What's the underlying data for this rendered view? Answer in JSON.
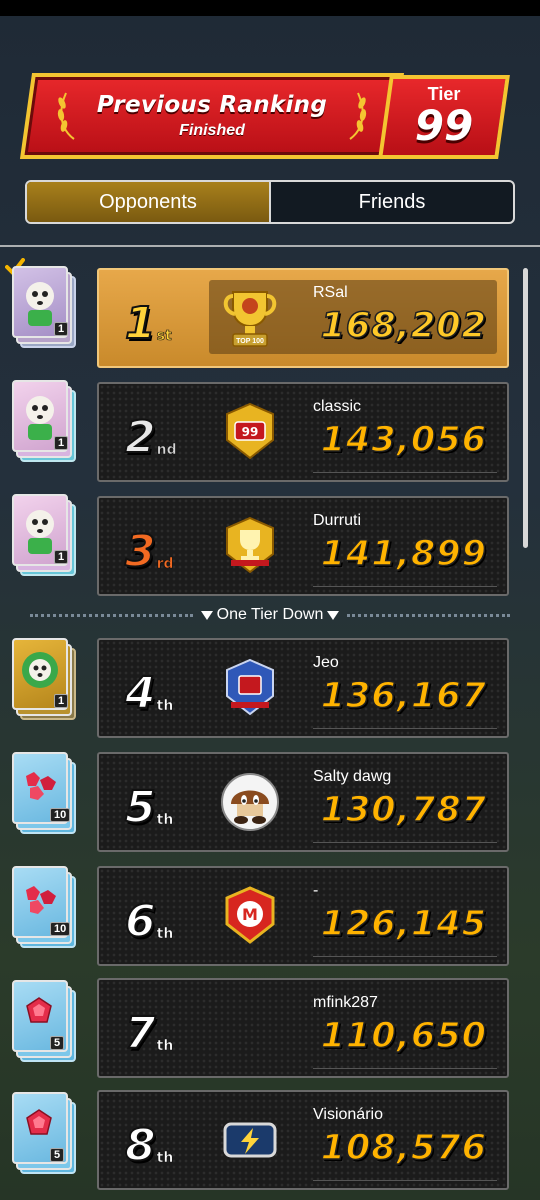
{
  "header": {
    "title": "Previous Ranking",
    "subtitle": "Finished",
    "tier_label": "Tier",
    "tier_value": "99"
  },
  "tabs": [
    {
      "label": "Opponents",
      "active": true
    },
    {
      "label": "Friends",
      "active": false
    }
  ],
  "separator": {
    "label": "One Tier Down"
  },
  "colors": {
    "banner_red": "#d71d22",
    "banner_gold": "#f4c531",
    "score_orange": "#ffb300",
    "first_row_bg": "#d9983b"
  },
  "rows": [
    {
      "rank": "1",
      "suffix": "st",
      "name": "RSal",
      "score": "168,202",
      "badge": "top-100-trophy-icon",
      "badge_text": "TOP 100",
      "avatar": "shy-guy-card",
      "card_count": "1",
      "checked": true
    },
    {
      "rank": "2",
      "suffix": "nd",
      "name": "classic",
      "score": "143,056",
      "badge": "tier-99-emblem-icon",
      "badge_text": "99",
      "avatar": "shy-guy-card",
      "card_count": "1"
    },
    {
      "rank": "3",
      "suffix": "rd",
      "name": "Durruti",
      "score": "141,899",
      "badge": "gold-trophy-emblem-icon",
      "badge_text": "",
      "avatar": "shy-guy-card",
      "card_count": "1"
    },
    {
      "rank": "4",
      "suffix": "th",
      "name": "Jeo",
      "score": "136,167",
      "badge": "blue-crest-emblem-icon",
      "badge_text": "",
      "avatar": "green-shy-guy-card",
      "card_count": "1"
    },
    {
      "rank": "5",
      "suffix": "th",
      "name": "Salty dawg",
      "score": "130,787",
      "badge": "goomba-badge-icon",
      "badge_text": "",
      "avatar": "ruby-card",
      "card_count": "10"
    },
    {
      "rank": "6",
      "suffix": "th",
      "name": "-",
      "score": "126,145",
      "badge": "mario-emblem-icon",
      "badge_text": "",
      "avatar": "ruby-card",
      "card_count": "10"
    },
    {
      "rank": "7",
      "suffix": "th",
      "name": "mfink287",
      "score": "110,650",
      "badge": "none",
      "badge_text": "",
      "avatar": "ruby-card-single",
      "card_count": "5"
    },
    {
      "rank": "8",
      "suffix": "th",
      "name": "Visionário",
      "score": "108,576",
      "badge": "lightning-badge-icon",
      "badge_text": "",
      "avatar": "ruby-card-single",
      "card_count": "5"
    }
  ]
}
